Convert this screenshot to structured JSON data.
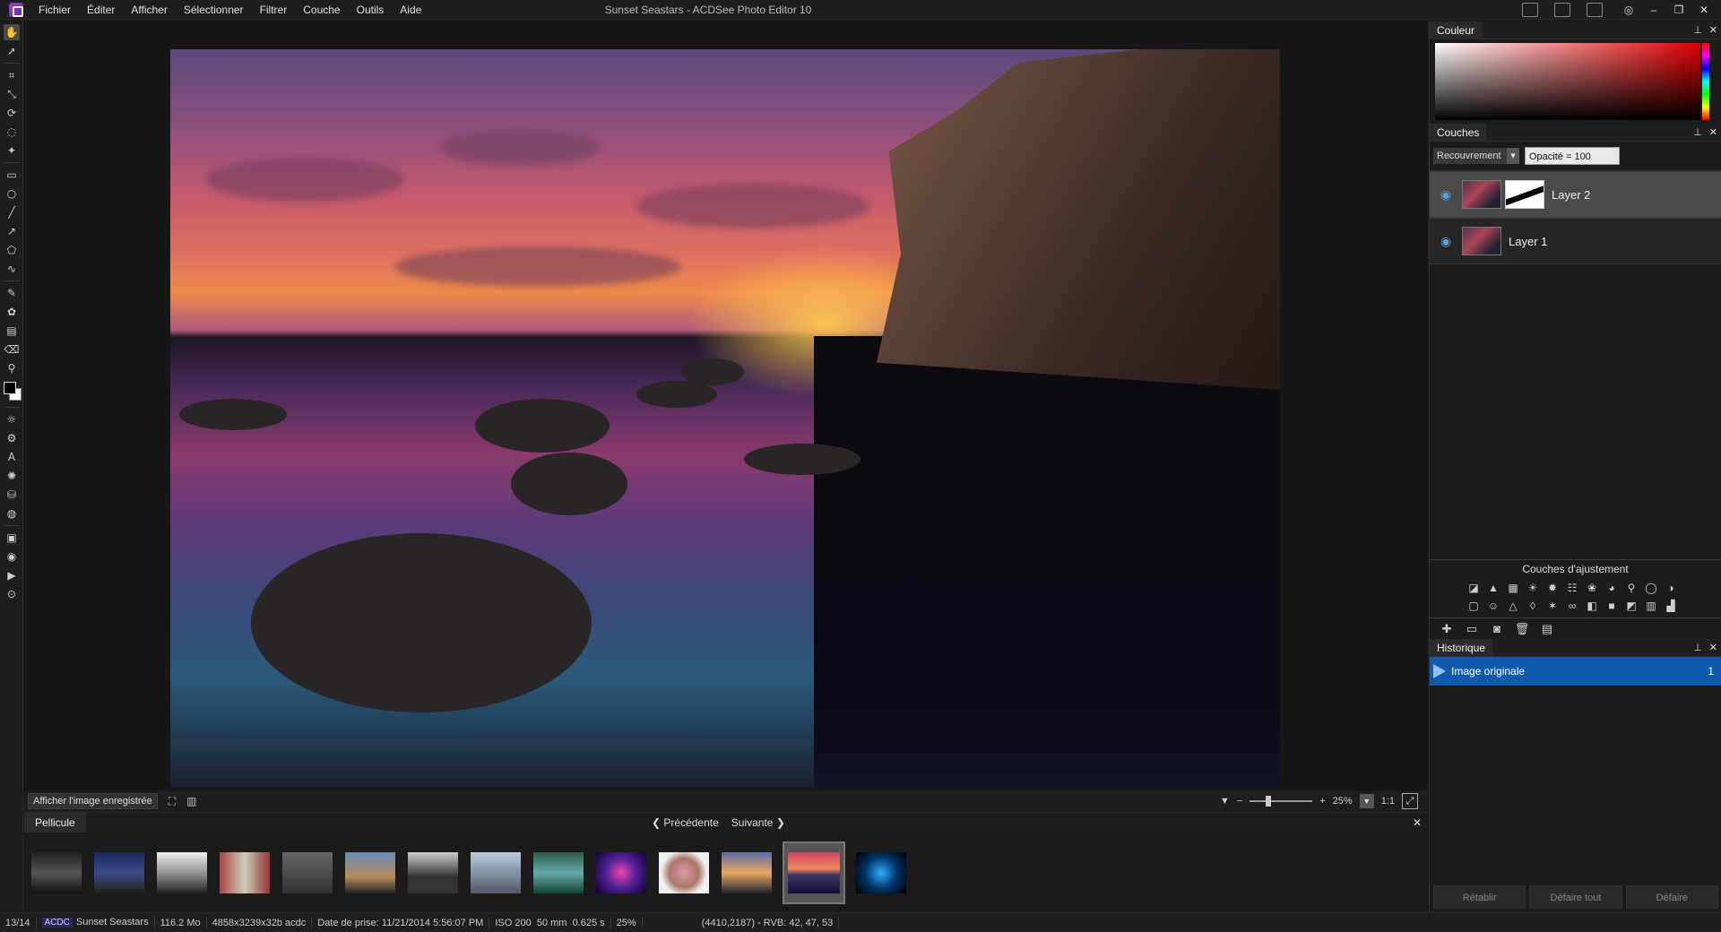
{
  "window": {
    "title": "Sunset Seastars - ACDSee Photo Editor 10"
  },
  "menu": [
    "Fichier",
    "Éditer",
    "Afficher",
    "Sélectionner",
    "Filtrer",
    "Couche",
    "Outils",
    "Aide"
  ],
  "canvas": {
    "show_saved_label": "Afficher l'image enregistrée",
    "zoom_percent": "25%",
    "zoom_ratio": "1:1"
  },
  "filmstrip": {
    "tab_label": "Pellicule",
    "prev_label": "Précédente",
    "next_label": "Suivante",
    "selected_index": 12,
    "thumbnail_count": 14
  },
  "status": {
    "index": "13/14",
    "badge": "ACDC",
    "filename": "Sunset Seastars",
    "size": "116.2 Mo",
    "dimensions": "4858x3239x32b acdc",
    "date": "Date de prise: 11/21/2014 5:56:07 PM",
    "iso": "ISO 200",
    "focal": "50 mm",
    "exposure": "0.625 s",
    "zoom": "25%",
    "pixel_info": "(4410,2187) - RVB: 42, 47, 53"
  },
  "panels": {
    "color": {
      "title": "Couleur"
    },
    "layers": {
      "title": "Couches",
      "blend_mode": "Recouvrement",
      "opacity": "Opacité = 100",
      "items": [
        {
          "name": "Layer 2",
          "selected": true
        },
        {
          "name": "Layer 1",
          "selected": false
        }
      ],
      "adjustment_title": "Couches d'ajustement"
    },
    "history": {
      "title": "Historique",
      "items": [
        {
          "label": "Image originale",
          "count": "1"
        }
      ],
      "redo_label": "Rétablir",
      "undo_all_label": "Défaire tout",
      "undo_label": "Défaire"
    }
  },
  "colors": {
    "accent": "#0f5aab",
    "panel": "#1c1c1c"
  }
}
